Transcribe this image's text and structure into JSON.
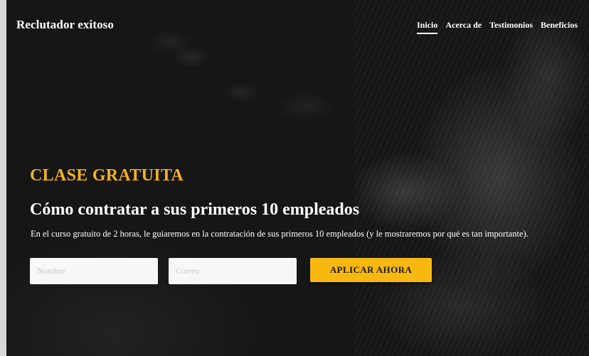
{
  "brand": "Reclutador exitoso",
  "nav": [
    {
      "label": "Inicio",
      "active": true
    },
    {
      "label": "Acerca de",
      "active": false
    },
    {
      "label": "Testimonios",
      "active": false
    },
    {
      "label": "Beneficios",
      "active": false
    }
  ],
  "hero": {
    "eyebrow": "CLASE GRATUITA",
    "headline": "Cómo contratar a sus primeros 10 empleados",
    "description": "En el curso gratuito de 2 horas, le guiaremos en la contratación de sus primeros 10 empleados (y le mostraremos por qué es tan importante)."
  },
  "form": {
    "name_placeholder": "Nombre",
    "email_placeholder": "Correo",
    "submit_label": "APLICAR AHORA"
  },
  "colors": {
    "accent": "#f6b21a",
    "button": "#f8b810",
    "background": "#161616",
    "text": "#ffffff"
  }
}
